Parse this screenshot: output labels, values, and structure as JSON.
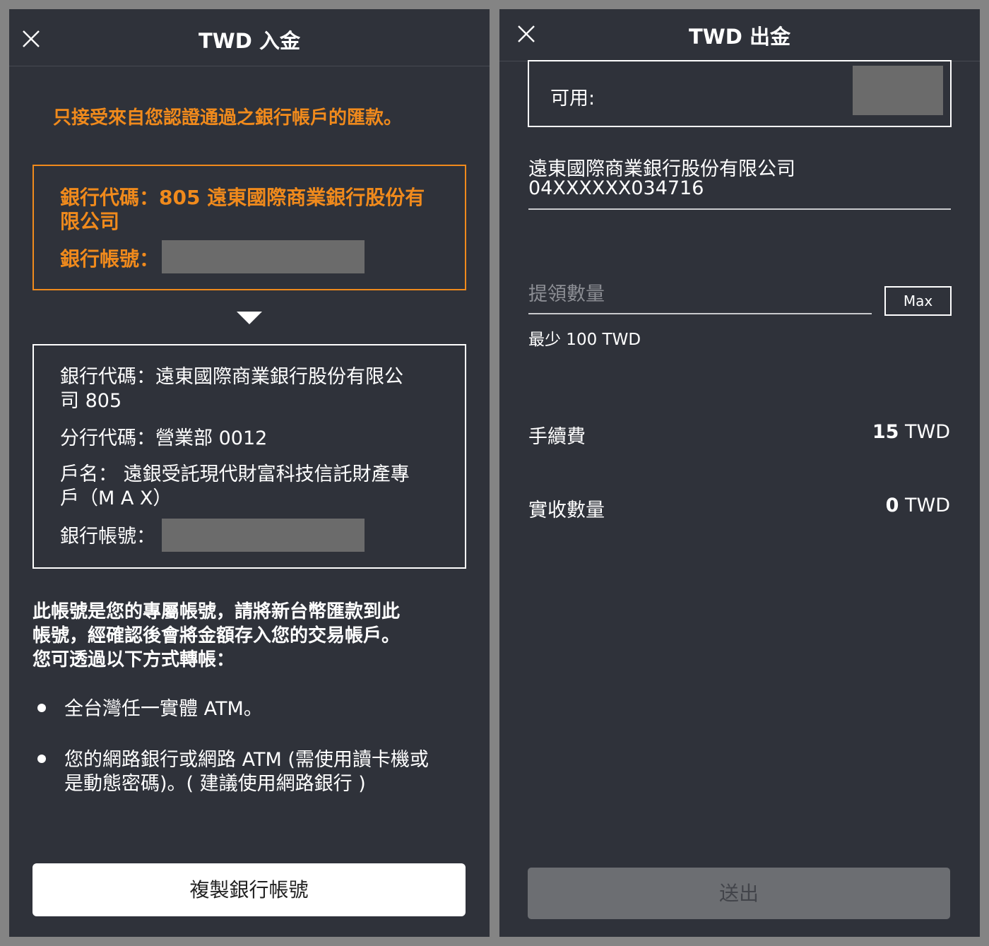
{
  "deposit": {
    "title": "TWD 入金",
    "notice": "只接受來自您認證通過之銀行帳戶的匯款。",
    "source_box": {
      "bank_code_line1": "銀行代碼：805 遠東國際商業銀行股份有",
      "bank_code_line2": "限公司",
      "account_label": "銀行帳號："
    },
    "target_box": {
      "bank_code_line1": "銀行代碼：遠東國際商業銀行股份有限公",
      "bank_code_line2": "司 805",
      "branch_line": "分行代碼：營業部 0012",
      "holder_line1": "戶名： 遠銀受託現代財富科技信託財產專",
      "holder_line2": "戶（M A X）",
      "account_label": "銀行帳號："
    },
    "instructions": {
      "line1": "此帳號是您的專屬帳號，請將新台幣匯款到此",
      "line2": "帳號，經確認後會將金額存入您的交易帳戶。",
      "line3": "您可透過以下方式轉帳："
    },
    "methods": [
      {
        "line1": "全台灣任一實體 ATM。",
        "line2": ""
      },
      {
        "line1": "您的網路銀行或網路 ATM (需使用讀卡機或",
        "line2": "是動態密碼)。( 建議使用網路銀行 )"
      }
    ],
    "copy_button": "複製銀行帳號"
  },
  "withdraw": {
    "title": "TWD 出金",
    "available_label": "可用:",
    "bank_name": "遠東國際商業銀行股份有限公司",
    "bank_account": "04XXXXXX034716",
    "amount_placeholder": "提領數量",
    "max_button": "Max",
    "min_note": "最少 100 TWD",
    "fee_label": "手續費",
    "fee_amount": "15",
    "fee_unit": " TWD",
    "receive_label": "實收數量",
    "receive_amount": "0",
    "receive_unit": " TWD",
    "submit_button": "送出"
  },
  "colors": {
    "background": "#848484",
    "panel": "#2f323a",
    "accent": "#f08a1c",
    "mask": "#6b6b6b"
  }
}
